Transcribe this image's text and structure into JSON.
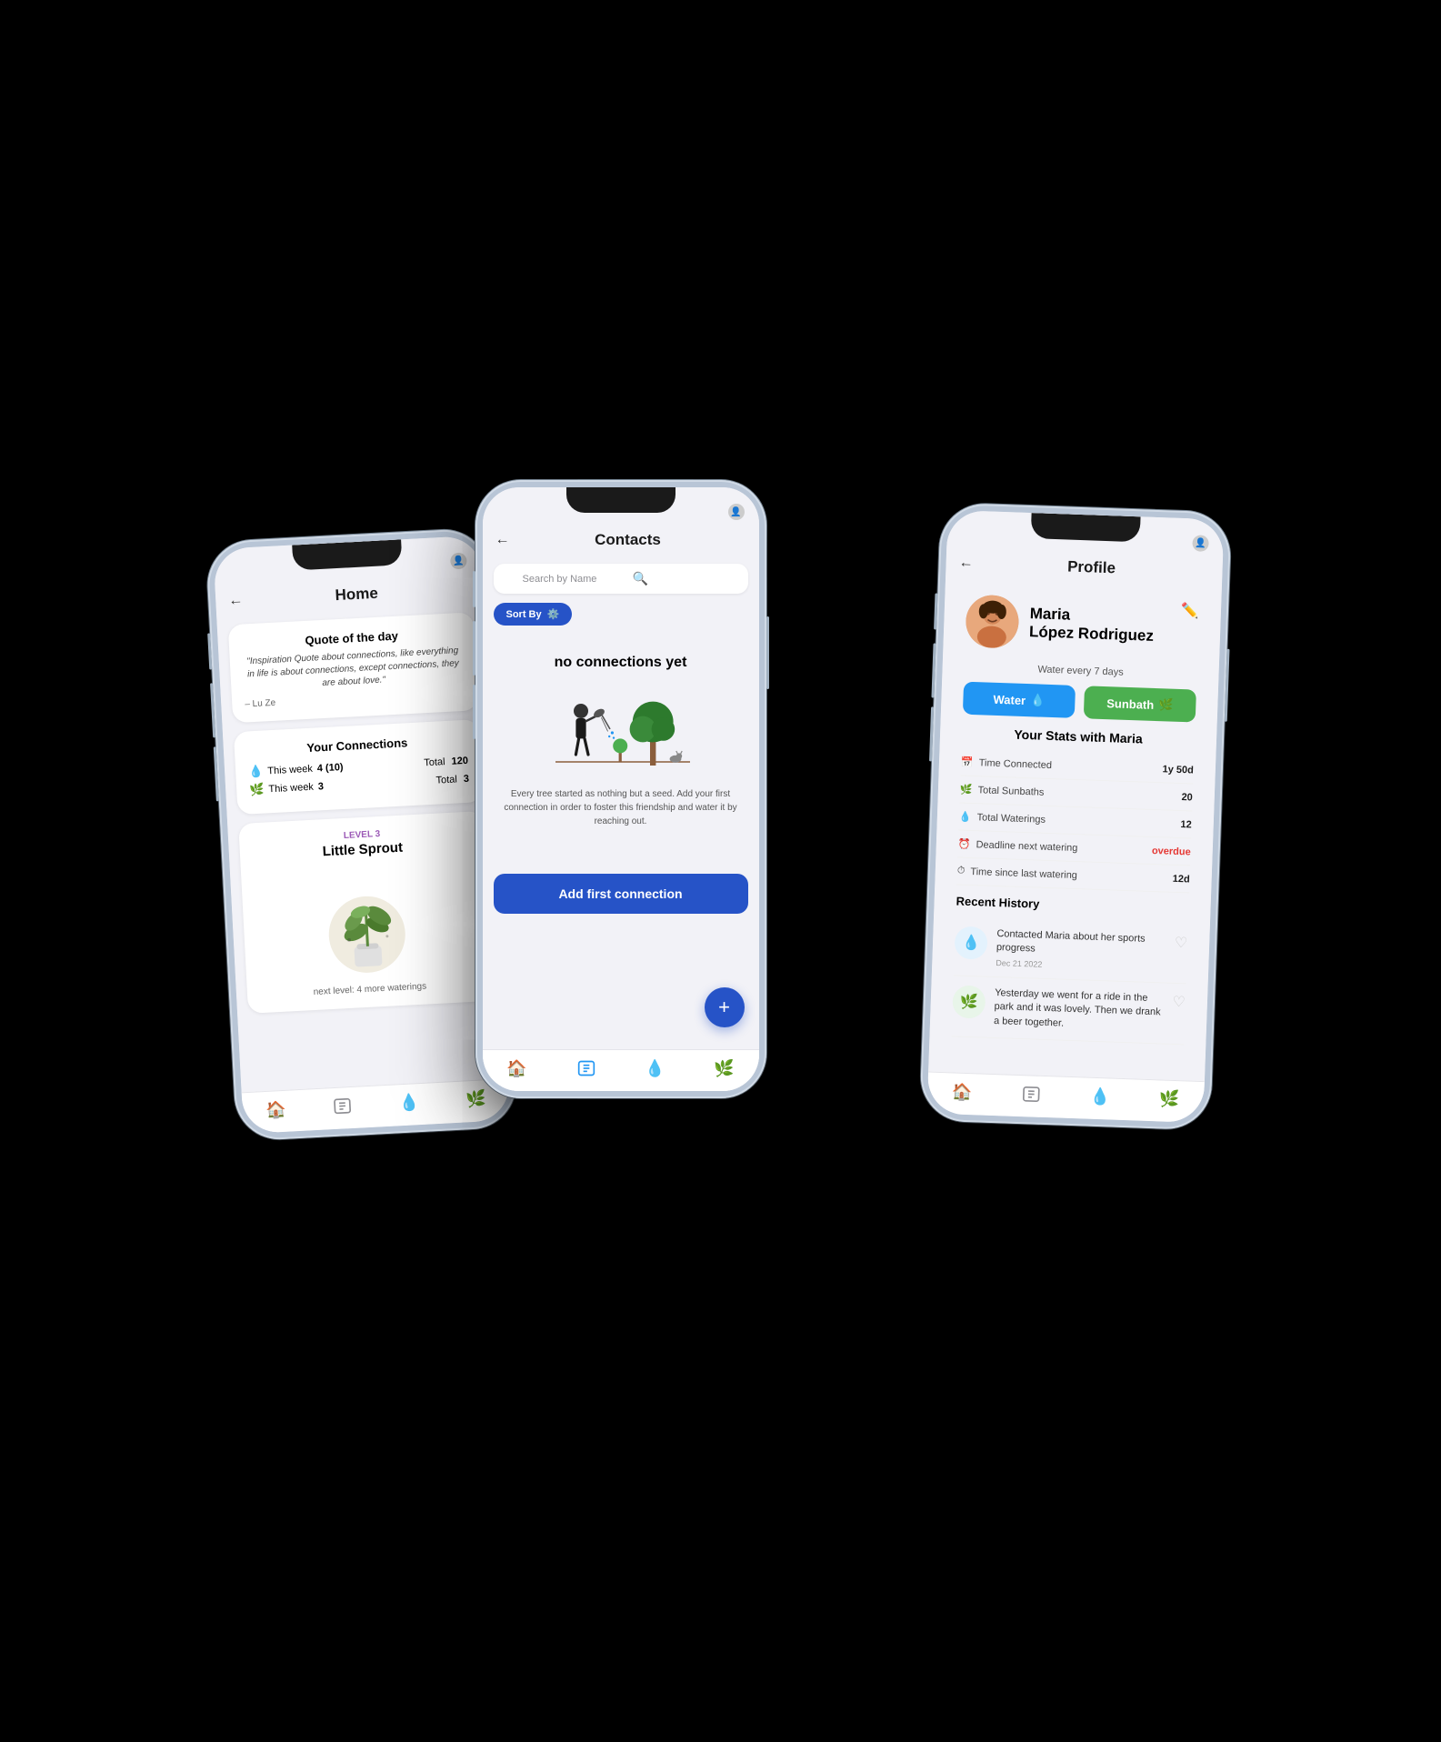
{
  "phone1": {
    "title": "Home",
    "quote": {
      "heading": "Quote of the day",
      "text": "\"Inspiration Quote about connections, like everything in life is about connections, except connections, they are about love.\"",
      "author": "– Lu Ze"
    },
    "connections": {
      "heading": "Your Connections",
      "water": {
        "label": "This week",
        "value": "4 (10)",
        "total_label": "Total",
        "total": "120"
      },
      "sun": {
        "label": "This week",
        "value": "3",
        "total_label": "Total",
        "total": "3"
      }
    },
    "level": {
      "label": "Level 3",
      "title": "Little Sprout",
      "next": "next level: 4 more waterings"
    },
    "tabs": {
      "home": "🏠",
      "contacts": "📋",
      "water": "💧",
      "sun": "🌿"
    }
  },
  "phone2": {
    "title": "Contacts",
    "search_placeholder": "Search by Name",
    "sort_label": "Sort By",
    "empty_heading": "no connections yet",
    "empty_text": "Every tree started as nothing but a seed.\nAdd your first connection in order to foster this friendship\nand water it by reaching out.",
    "add_button": "Add first connection",
    "fab_label": "+",
    "tabs": {
      "home": "🏠",
      "contacts": "📋",
      "water": "💧",
      "sun": "🌿"
    }
  },
  "phone3": {
    "title": "Profile",
    "user": {
      "name": "Maria\nLópez Rodriguez",
      "name_line1": "Maria",
      "name_line2": "López Rodriguez",
      "water_interval": "Water every 7 days",
      "avatar_emoji": "👩"
    },
    "buttons": {
      "water": "Water",
      "sunbath": "Sunbath"
    },
    "stats": {
      "heading": "Your Stats with Maria",
      "rows": [
        {
          "icon": "📅",
          "label": "Time Connected",
          "value": "1y 50d"
        },
        {
          "icon": "🌿",
          "label": "Total Sunbaths",
          "value": "20"
        },
        {
          "icon": "💧",
          "label": "Total Waterings",
          "value": "12"
        },
        {
          "icon": "⏰",
          "label": "Deadline next watering",
          "value": "overdue",
          "is_overdue": true
        },
        {
          "icon": "⏱",
          "label": "Time since last watering",
          "value": "12d"
        }
      ]
    },
    "history": {
      "heading": "Recent History",
      "items": [
        {
          "type": "water",
          "text": "Contacted Maria about her sports progress",
          "date": "Dec 21 2022",
          "icon": "💧"
        },
        {
          "type": "sun",
          "text": "Yesterday we went for a ride in the park and it was lovely. Then we drank a beer together.",
          "date": "",
          "icon": "🌿"
        }
      ]
    },
    "tabs": {
      "home": "🏠",
      "contacts": "📋",
      "water": "💧",
      "sun": "🌿"
    }
  }
}
